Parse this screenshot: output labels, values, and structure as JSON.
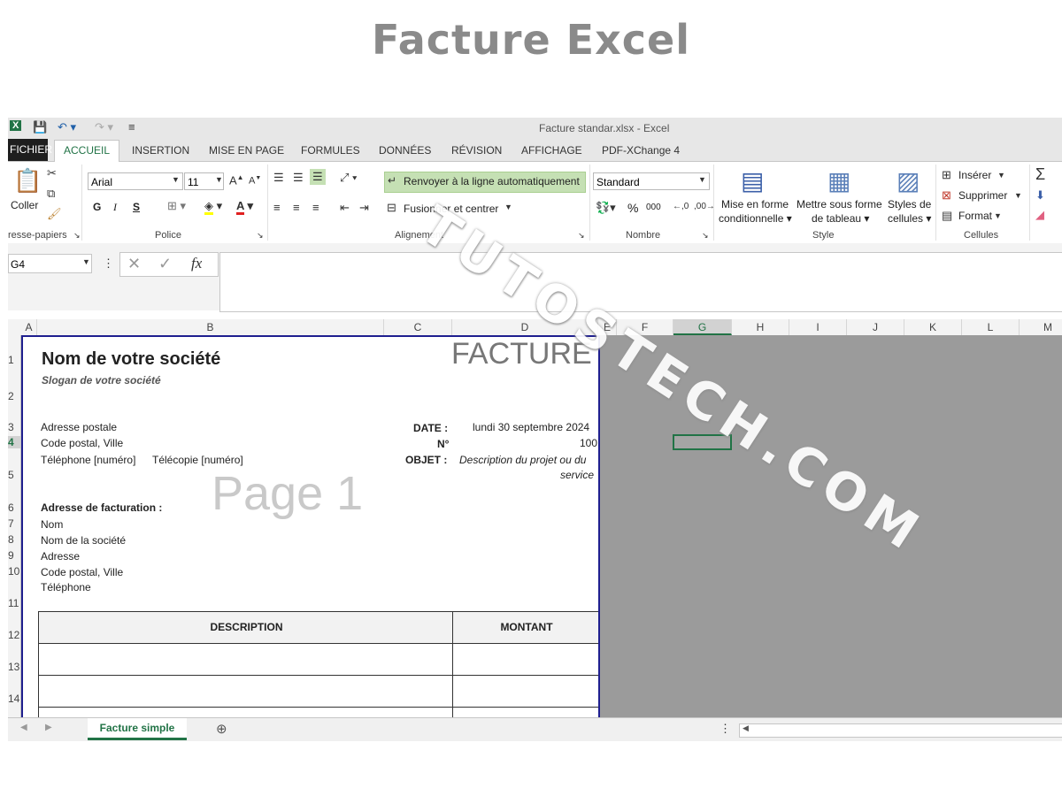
{
  "banner_title": "Facture Excel",
  "window": {
    "title": "Facture standar.xlsx - Excel"
  },
  "tabs": [
    "FICHIER",
    "ACCUEIL",
    "INSERTION",
    "MISE EN PAGE",
    "FORMULES",
    "DONNÉES",
    "RÉVISION",
    "AFFICHAGE",
    "PDF-XChange 4"
  ],
  "ribbon": {
    "clipboard": {
      "paste": "Coller",
      "label": "resse-papiers"
    },
    "font": {
      "name": "Arial",
      "size": "11",
      "bold": "G",
      "italic": "I",
      "underline": "S",
      "label": "Police"
    },
    "alignment": {
      "wrap": "Renvoyer à la ligne automatiquement",
      "merge": "Fusionner et centrer",
      "label": "Alignement"
    },
    "number": {
      "format": "Standard",
      "percent": "%",
      "thousands": "000",
      "label": "Nombre"
    },
    "style": {
      "conditional": "Mise en forme conditionnelle",
      "table": "Mettre sous forme de tableau",
      "cellstyles": "Styles de cellules",
      "label": "Style"
    },
    "cells": {
      "insert": "Insérer",
      "delete": "Supprimer",
      "format": "Format",
      "label": "Cellules"
    }
  },
  "formula_bar": {
    "name_box": "G4",
    "value": ""
  },
  "columns": [
    "A",
    "B",
    "C",
    "D",
    "E",
    "F",
    "G",
    "H",
    "I",
    "J",
    "K",
    "L",
    "M"
  ],
  "rows": [
    "1",
    "2",
    "3",
    "4",
    "5",
    "6",
    "7",
    "8",
    "9",
    "10",
    "11",
    "12",
    "13",
    "14"
  ],
  "invoice": {
    "company": "Nom de votre société",
    "slogan": "Slogan de votre société",
    "heading": "FACTURE",
    "address": "Adresse postale",
    "city": "Code postal, Ville",
    "phone": "Téléphone [numéro]",
    "fax": "Télécopie [numéro]",
    "date_label": "DATE :",
    "date_value": "lundi 30 septembre 2024",
    "num_label": "N°",
    "num_value": "100",
    "object_label": "OBJET :",
    "object_value_1": "Description du projet ou du",
    "object_value_2": "service",
    "billing_title": "Adresse de facturation :",
    "billing": [
      "Nom",
      "Nom de la société",
      "Adresse",
      "Code postal, Ville",
      "Téléphone"
    ],
    "table_headers": [
      "DESCRIPTION",
      "MONTANT"
    ],
    "page_watermark": "Page 1"
  },
  "sheet_tab": "Facture simple",
  "site_watermark": "TUTOSTECH.COM"
}
